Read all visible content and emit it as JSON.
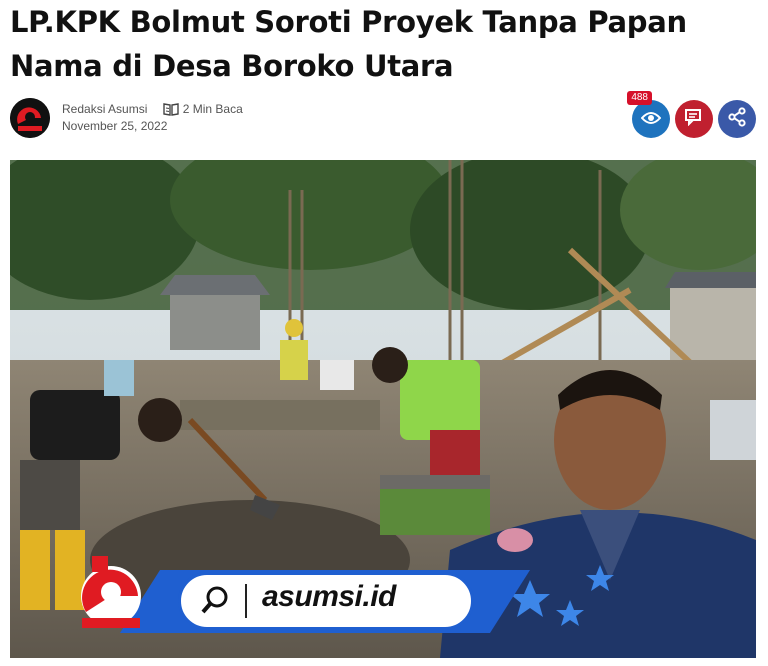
{
  "article": {
    "title": "LP.KPK Bolmut Soroti Proyek Tanpa Papan Nama di Desa Boroko Utara",
    "author": "Redaksi Asumsi",
    "read_time": "2 Min Baca",
    "date": "November 25, 2022"
  },
  "actions": {
    "views_count": "488",
    "views_icon": "eye-icon",
    "comments_icon": "comment-icon",
    "share_icon": "share-icon"
  },
  "image": {
    "watermark_text": "asumsi.id",
    "watermark_icon": "search-icon"
  },
  "colors": {
    "views": "#1e73be",
    "comments": "#c0202f",
    "share": "#3a59a8",
    "badge": "#d6102a",
    "brand_blue": "#1f5fd0",
    "brand_red": "#e01b22"
  }
}
